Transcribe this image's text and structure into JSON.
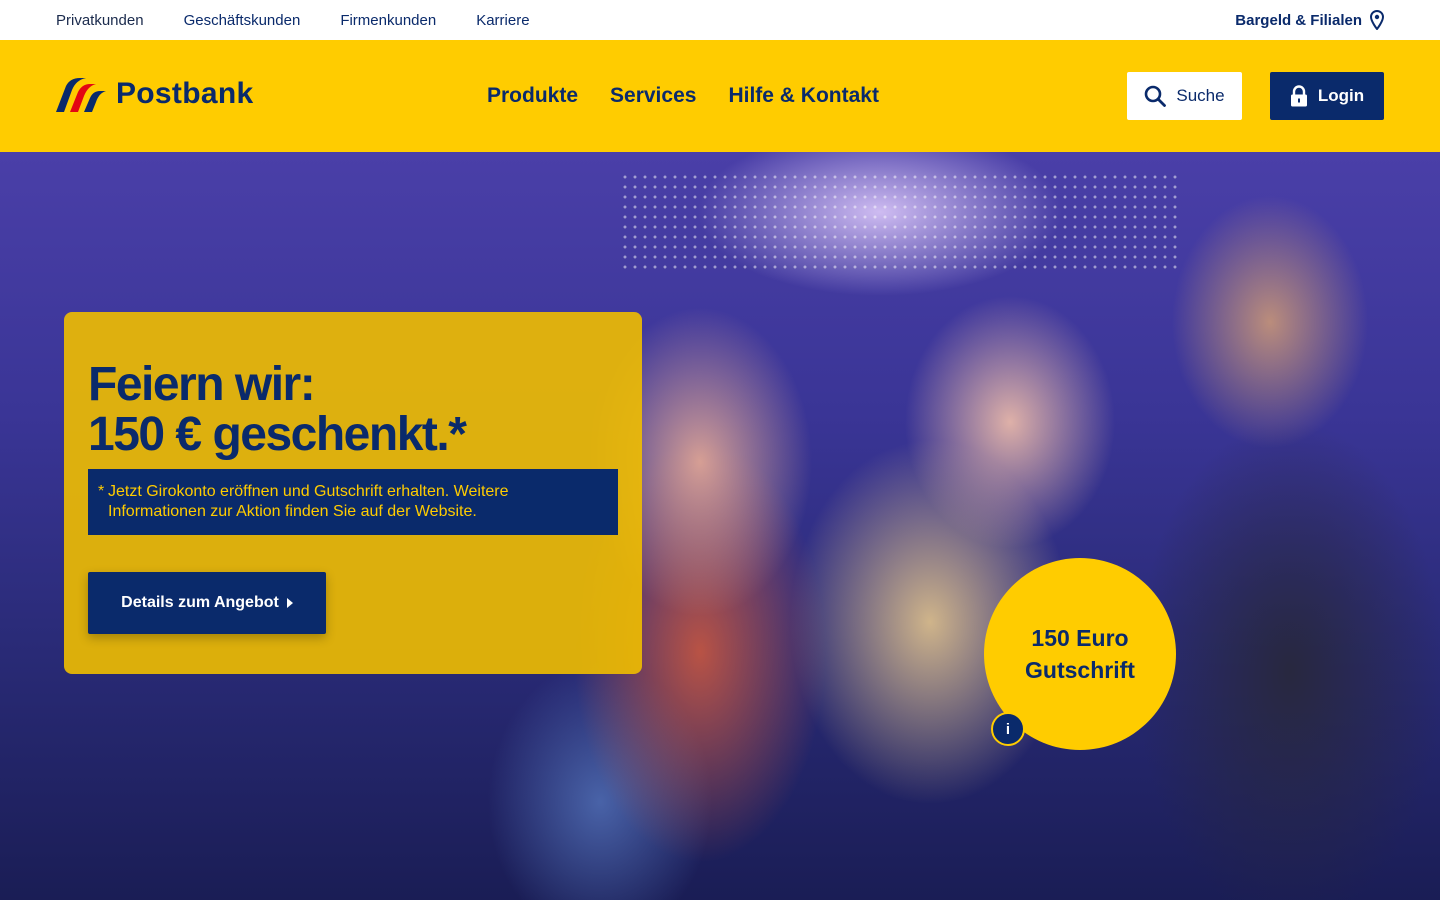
{
  "topbar": {
    "links": [
      "Privatkunden",
      "Geschäftskunden",
      "Firmenkunden",
      "Karriere"
    ],
    "branches_label": "Bargeld & Filialen"
  },
  "header": {
    "logo_text": "Postbank",
    "nav": [
      "Produkte",
      "Services",
      "Hilfe & Kontakt"
    ],
    "search_label": "Suche",
    "login_label": "Login"
  },
  "hero": {
    "title_line1": "Feiern wir:",
    "title_line2": "150 € geschenkt.*",
    "note_star": "*",
    "note": "Jetzt Girokonto eröffnen und Gutschrift erhalten. Weitere Informationen zur Aktion finden Sie auf der Website.",
    "cta_label": "Details zum Angebot",
    "badge_line1": "150 Euro",
    "badge_line2": "Gutschrift",
    "info_label": "i"
  },
  "colors": {
    "brand_yellow": "#ffcc00",
    "brand_blue": "#0a2a6b",
    "logo_red": "#e30613"
  },
  "icons": [
    "location-pin-icon",
    "search-icon",
    "lock-icon",
    "chevron-right-icon",
    "info-icon"
  ]
}
